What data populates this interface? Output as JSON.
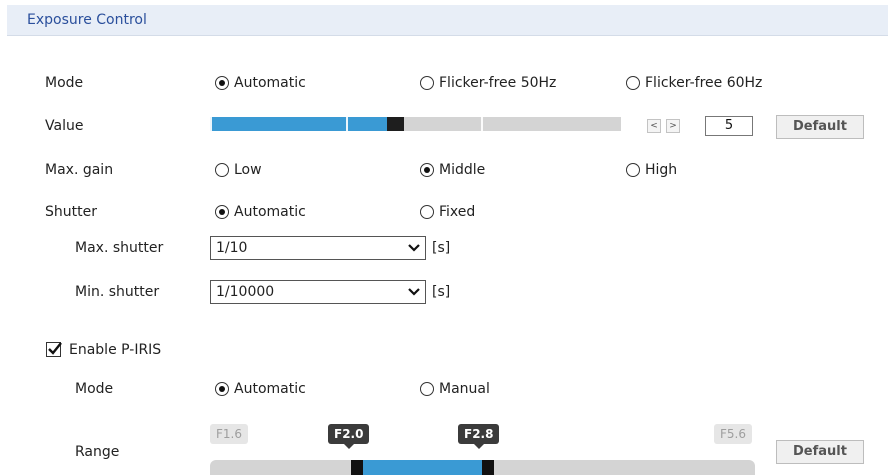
{
  "section": {
    "title": "Exposure Control"
  },
  "exposure": {
    "mode": {
      "label": "Mode",
      "options": [
        "Automatic",
        "Flicker-free 50Hz",
        "Flicker-free 60Hz"
      ],
      "selected": "Automatic"
    },
    "value": {
      "label": "Value",
      "value": "5",
      "slider_fraction": 0.45,
      "dec_symbol": "<",
      "inc_symbol": ">",
      "default_label": "Default"
    },
    "max_gain": {
      "label": "Max. gain",
      "options": [
        "Low",
        "Middle",
        "High"
      ],
      "selected": "Middle"
    },
    "shutter": {
      "label": "Shutter",
      "options": [
        "Automatic",
        "Fixed"
      ],
      "selected": "Automatic",
      "max": {
        "label": "Max. shutter",
        "value": "1/10",
        "unit": "[s]"
      },
      "min": {
        "label": "Min. shutter",
        "value": "1/10000",
        "unit": "[s]"
      }
    }
  },
  "piris": {
    "enable_label": "Enable P-IRIS",
    "enabled": true,
    "mode": {
      "label": "Mode",
      "options": [
        "Automatic",
        "Manual"
      ],
      "selected": "Automatic"
    },
    "range": {
      "label": "Range",
      "min_label": "F1.6",
      "max_label": "F5.6",
      "low_value": "F2.0",
      "high_value": "F2.8",
      "low_fraction": 0.27,
      "high_fraction": 0.51,
      "default_label": "Default"
    }
  },
  "colors": {
    "accent": "#3a9ad4",
    "header_bg": "#e8eef7",
    "header_text": "#2a4f9c"
  },
  "icons": {
    "dropdown": "chevron-down-icon",
    "check": "checkmark-icon"
  }
}
